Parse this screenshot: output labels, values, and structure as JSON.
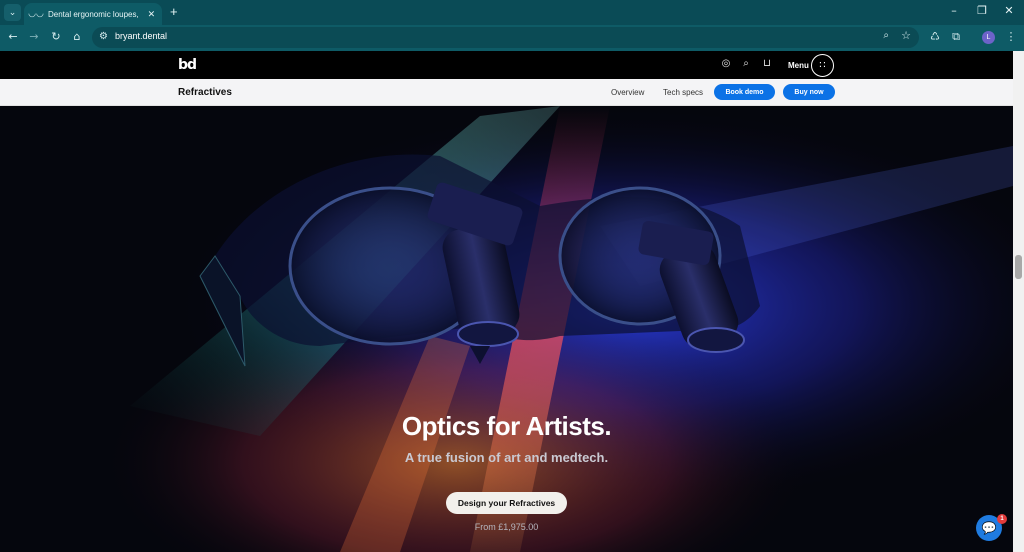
{
  "browser": {
    "tab_title": "Dental ergonomic loupes, head",
    "url": "bryant.dental",
    "profile_initial": "L",
    "icons": {
      "tab_search": "chevron-down-icon",
      "tab_close": "close-icon",
      "new_tab": "plus-icon",
      "back": "arrow-left-icon",
      "forward": "arrow-right-icon",
      "reload": "reload-icon",
      "home": "home-icon",
      "site_settings": "tune-icon",
      "zoom": "zoom-icon",
      "bookmark": "star-icon",
      "extension": "extension-icon",
      "puzzle": "puzzle-icon",
      "more": "kebab-icon"
    }
  },
  "site": {
    "logo": "bd",
    "menu_label": "Menu",
    "subnav": {
      "title": "Refractives",
      "links": [
        "Overview",
        "Tech specs"
      ],
      "book_demo": "Book demo",
      "buy_now": "Buy now"
    },
    "hero": {
      "title": "Optics for Artists.",
      "subtitle": "A true fusion of art and medtech.",
      "cta": "Design your Refractives",
      "price": "From £1,975.00"
    },
    "chat_badge": "1"
  }
}
